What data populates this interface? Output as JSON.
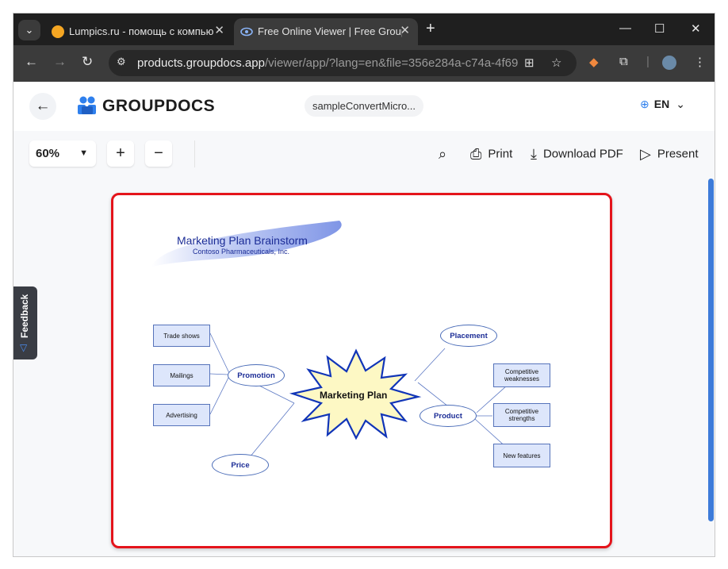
{
  "browser": {
    "tabs": [
      {
        "title": "Lumpics.ru - помощь с компьютером",
        "active": false
      },
      {
        "title": "Free Online Viewer | Free GroupDocs App",
        "active": true
      }
    ],
    "new_tab": "+",
    "url_host": "products.groupdocs.app",
    "url_path": "/viewer/app/?lang=en&file=356e284a-c74a-4f69-...",
    "window_controls": {
      "minimize": "—",
      "maximize": "☐",
      "close": "✕"
    }
  },
  "app": {
    "brand": "GROUPDOCS",
    "file_name": "sampleConvertMicro...",
    "language": "EN"
  },
  "viewer": {
    "zoom": "60%",
    "zoom_in": "+",
    "zoom_out": "−",
    "actions": {
      "print": "Print",
      "download": "Download PDF",
      "present": "Present"
    }
  },
  "feedback": "Feedback",
  "diagram": {
    "title": "Marketing Plan Brainstorm",
    "subtitle": "Contoso Pharmaceuticals, Inc.",
    "center": "Marketing Plan",
    "hubs": {
      "promotion": "Promotion",
      "price": "Price",
      "placement": "Placement",
      "product": "Product"
    },
    "promotion_items": [
      "Trade shows",
      "Mailings",
      "Advertising"
    ],
    "product_items": [
      "Competitive weaknesses",
      "Competitive strengths",
      "New features"
    ]
  },
  "colors": {
    "highlight": "#e4141b",
    "accent": "#3d7bd9",
    "diagram_blue": "#1b2c96",
    "star_fill": "#fdf8c4"
  }
}
